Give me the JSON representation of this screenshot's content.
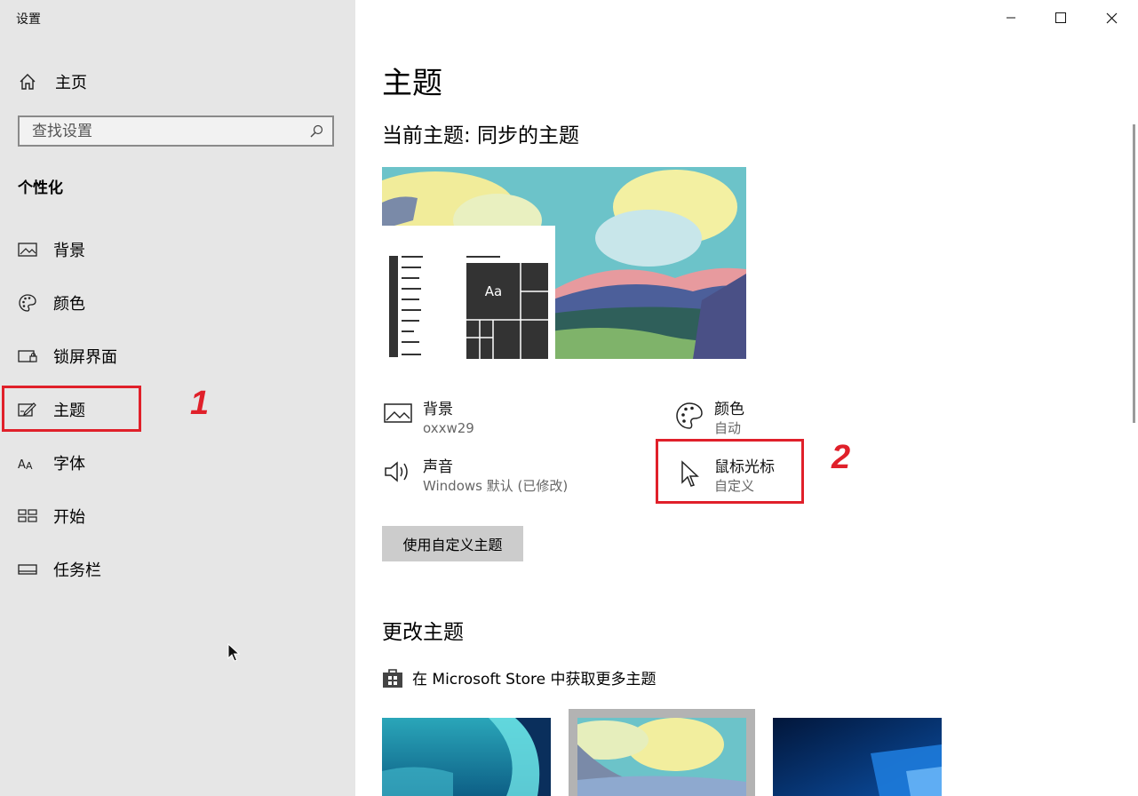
{
  "app": {
    "title": "设置"
  },
  "sidebar": {
    "home_label": "主页",
    "search_placeholder": "查找设置",
    "section": "个性化",
    "items": [
      {
        "label": "背景",
        "icon": "picture-icon"
      },
      {
        "label": "颜色",
        "icon": "palette-icon"
      },
      {
        "label": "锁屏界面",
        "icon": "lock-screen-icon"
      },
      {
        "label": "主题",
        "icon": "theme-icon",
        "selected": true
      },
      {
        "label": "字体",
        "icon": "font-icon"
      },
      {
        "label": "开始",
        "icon": "start-icon"
      },
      {
        "label": "任务栏",
        "icon": "taskbar-icon"
      }
    ]
  },
  "annotations": {
    "mark1": "1",
    "mark2": "2",
    "color": "#e0202a"
  },
  "main": {
    "title": "主题",
    "current_theme": "当前主题: 同步的主题",
    "preview_sample": "Aa",
    "props": {
      "background": {
        "title": "背景",
        "value": "oxxw29"
      },
      "color": {
        "title": "颜色",
        "value": "自动"
      },
      "sound": {
        "title": "声音",
        "value": "Windows 默认 (已修改)"
      },
      "cursor": {
        "title": "鼠标光标",
        "value": "自定义"
      }
    },
    "custom_button": "使用自定义主题",
    "change_heading": "更改主题",
    "store_link": "在 Microsoft Store 中获取更多主题"
  },
  "colors": {
    "sidebar_bg": "#e6e6e6",
    "button_bg": "#cccccc",
    "accent_red": "#e0202a"
  }
}
